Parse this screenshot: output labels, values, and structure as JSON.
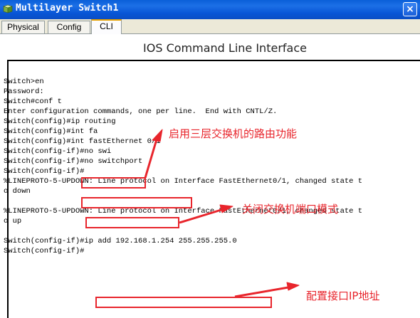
{
  "window": {
    "title": "Multilayer Switch1",
    "close_glyph": "×"
  },
  "tabs": [
    {
      "label": "Physical"
    },
    {
      "label": "Config"
    },
    {
      "label": "CLI"
    }
  ],
  "heading": "IOS Command Line Interface",
  "console_lines": [
    "Switch>en",
    "Password:",
    "Switch#conf t",
    "Enter configuration commands, one per line.  End with CNTL/Z.",
    "Switch(config)#ip routing",
    "Switch(config)#int fa",
    "Switch(config)#int fastEthernet 0/1",
    "Switch(config-if)#no swi",
    "Switch(config-if)#no switchport",
    "Switch(config-if)#",
    "%LINEPROTO-5-UPDOWN: Line protocol on Interface FastEthernet0/1, changed state t",
    "o down",
    "",
    "%LINEPROTO-5-UPDOWN: Line protocol on Interface FastEthernet0/1, changed state t",
    "o up",
    "",
    "Switch(config-if)#ip add 192.168.1.254 255.255.255.0",
    "Switch(config-if)#"
  ],
  "annotations": {
    "ip_routing": "启用三层交换机的路由功能",
    "no_switchport": "关闭交换机端口模式",
    "ip_address": "配置接口IP地址"
  },
  "colors": {
    "annotation": "#e8252c",
    "titlebar": "#0a5fd8",
    "active_tab_accent": "#e6a000"
  }
}
